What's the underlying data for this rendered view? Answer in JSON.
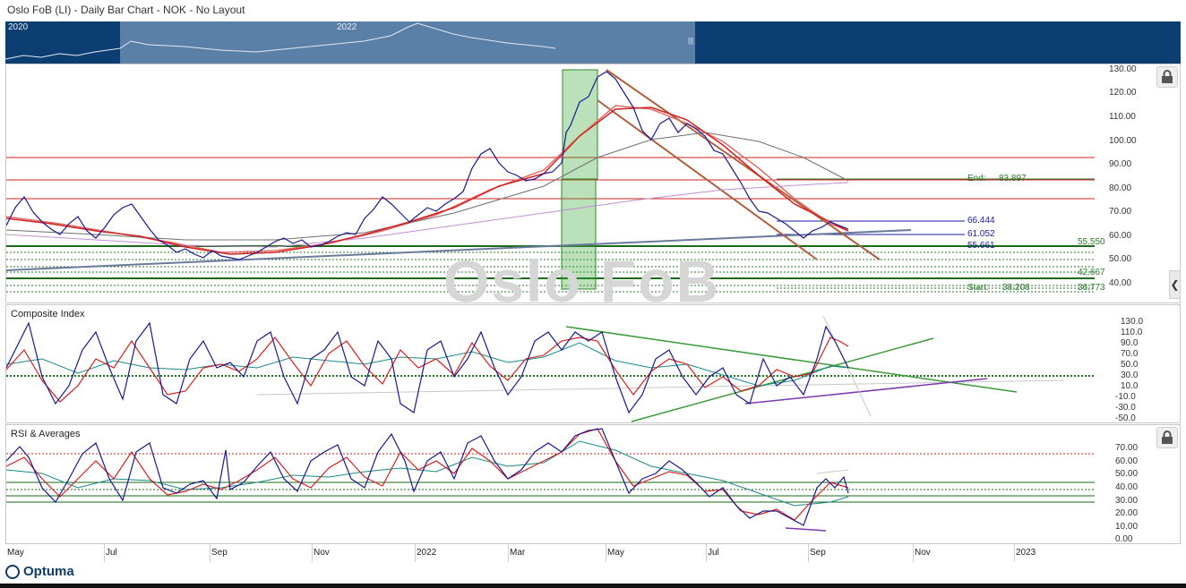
{
  "header": {
    "title": "Oslo FoB (LI) - Daily Bar Chart - NOK - No Layout"
  },
  "overview": {
    "year_left": "2020",
    "year_right": "2022",
    "handle": "|||"
  },
  "watermark": "Oslo FoB",
  "price_pane": {
    "y_ticks": [
      "130.00",
      "120.00",
      "110.00",
      "100.00",
      "90.00",
      "80.00",
      "70.00",
      "60.00",
      "50.00",
      "40.00"
    ],
    "labels": {
      "end": "End:",
      "end_value": "83.897",
      "level_1": "66.444",
      "level_2": "61.052",
      "level_3": "55.661",
      "level_4": "55.550",
      "level_5": "42.667",
      "start": "Start:",
      "start_value": "38.208",
      "level_6": "36.773"
    }
  },
  "composite_pane": {
    "title": "Composite Index",
    "y_ticks": [
      "130.0",
      "110.0",
      "90.0",
      "70.0",
      "50.0",
      "30.0",
      "10.0",
      "-10.0",
      "-30.0",
      "-50.0"
    ]
  },
  "rsi_pane": {
    "title": "RSI & Averages",
    "y_ticks": [
      "70.00",
      "60.00",
      "50.00",
      "40.00",
      "30.00",
      "20.00",
      "10.00",
      "0.00"
    ]
  },
  "x_axis": {
    "months": [
      "May",
      "Jul",
      "Sep",
      "Nov",
      "2022",
      "Mar",
      "May",
      "Jul",
      "Sep",
      "Nov",
      "2023"
    ]
  },
  "branding": {
    "logo": "Optuma"
  },
  "colors": {
    "navy": "#0c3e72",
    "price": "#1a1a8c",
    "ma_red": "#d42020",
    "ma_teal": "#1a8a8a",
    "trend_brown": "#b06040",
    "green": "#2a9a2a",
    "purple": "#7a3ab0"
  }
}
